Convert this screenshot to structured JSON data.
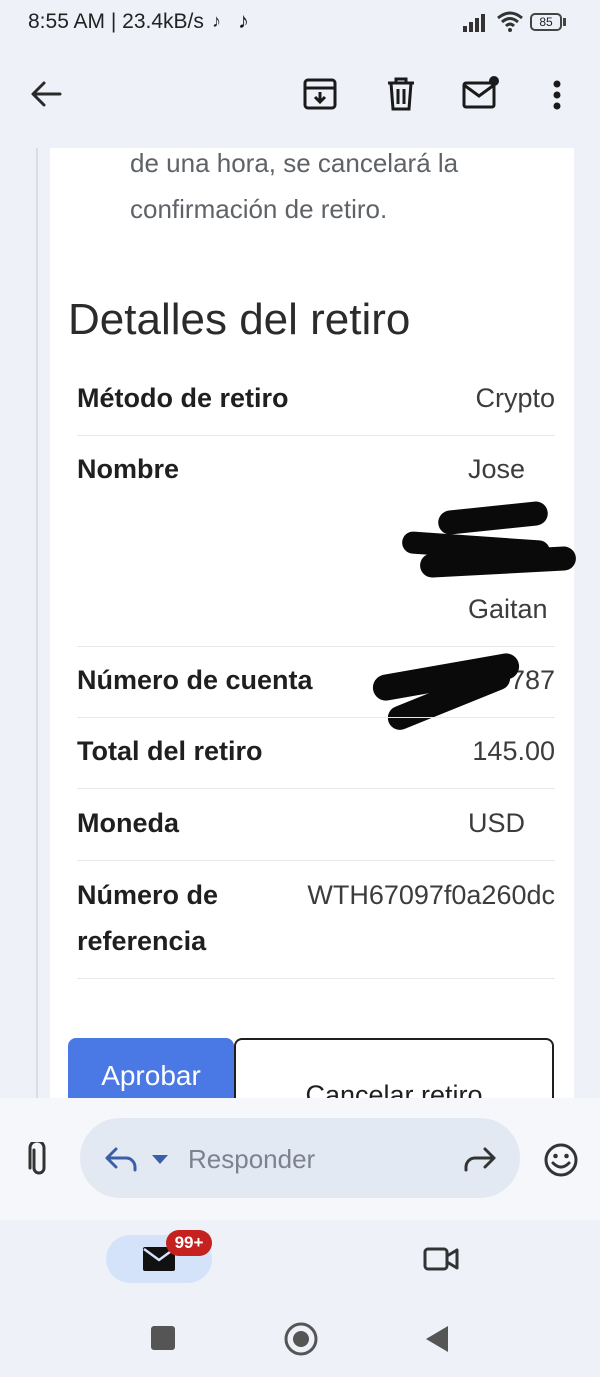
{
  "status_bar": {
    "time_speed": "8:55 AM | 23.4kB/s",
    "battery": "85"
  },
  "toolbar": {
    "back": "arrow-left-icon",
    "archive": "archive-icon",
    "delete": "trash-icon",
    "mark_unread": "mail-unread-icon",
    "more": "more-vert-icon"
  },
  "email": {
    "intro_line1": "de una hora, se cancelará la",
    "intro_line2": "confirmación de retiro.",
    "section_title": "Detalles del retiro",
    "rows": [
      {
        "label": "Método de retiro",
        "value": "Crypto"
      },
      {
        "label": "Nombre",
        "value_first": "Jose",
        "value_last": "Gaitan"
      },
      {
        "label": "Número de cuenta",
        "value": "787"
      },
      {
        "label": "Total del retiro",
        "value": "145.00"
      },
      {
        "label": "Moneda",
        "value": "USD"
      },
      {
        "label_line1": "Número de",
        "label_line2": "referencia",
        "value": "WTH67097f0a260dc"
      }
    ],
    "approve_button": "Aprobar",
    "cancel_button": "Cancelar retiro"
  },
  "reply_bar": {
    "placeholder": "Responder"
  },
  "bottom_nav": {
    "mail_badge": "99+"
  },
  "colors": {
    "accent": "#4a79e6",
    "badge": "#c5221f",
    "surface": "#eef2f8"
  }
}
